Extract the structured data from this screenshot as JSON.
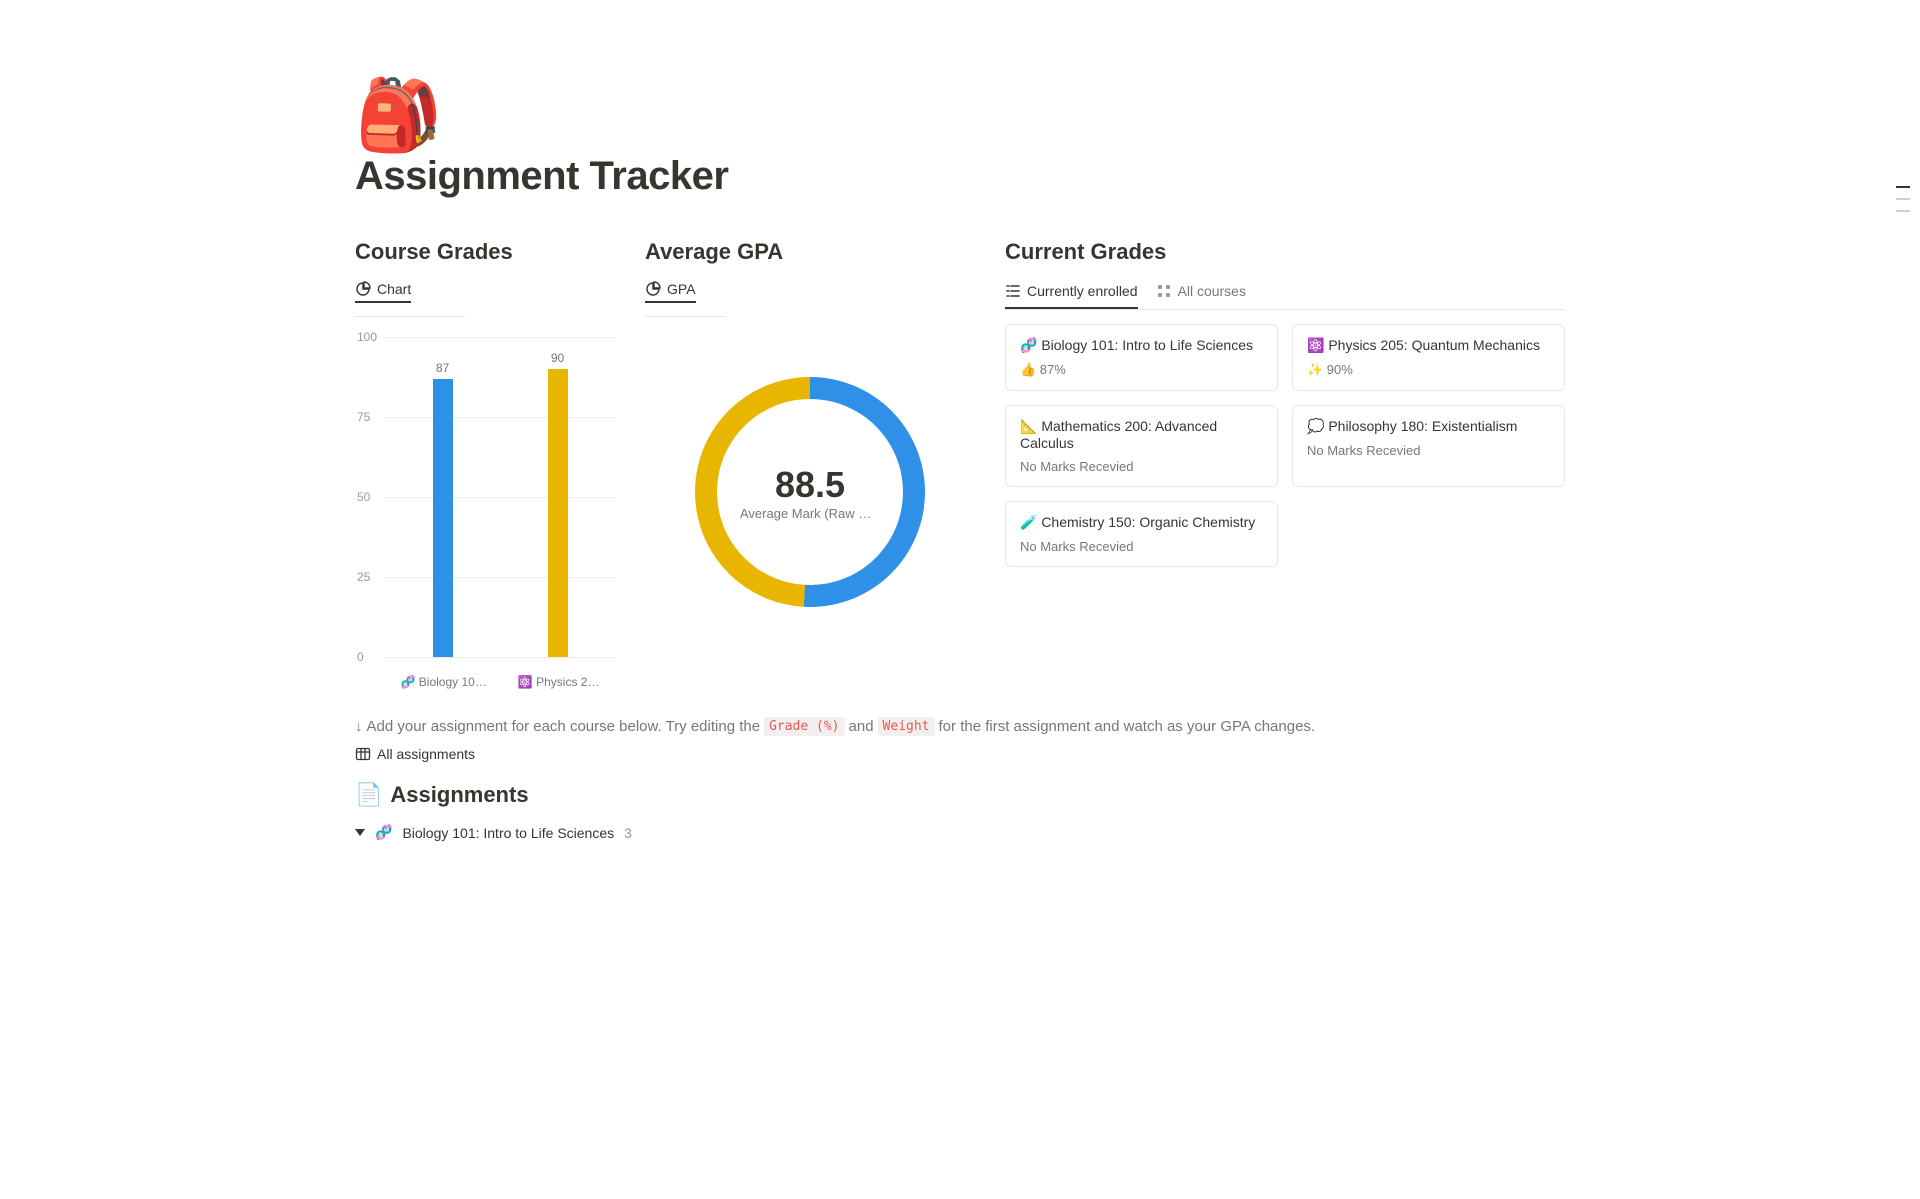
{
  "page": {
    "icon": "🎒",
    "title": "Assignment Tracker"
  },
  "course_grades": {
    "title": "Course Grades",
    "tab_label": "Chart"
  },
  "average_gpa": {
    "title": "Average GPA",
    "tab_label": "GPA",
    "value": "88.5",
    "caption": "Average Mark (Raw Nu…"
  },
  "current_grades": {
    "title": "Current Grades",
    "tabs": [
      {
        "label": "Currently enrolled"
      },
      {
        "label": "All courses"
      }
    ],
    "cards": [
      {
        "emoji": "🧬",
        "title": "Biology 101: Intro to Life Sciences",
        "sub_emoji": "👍",
        "sub": "87%"
      },
      {
        "emoji": "⚛️",
        "title": "Physics 205: Quantum Mechanics",
        "sub_emoji": "✨",
        "sub": "90%"
      },
      {
        "emoji": "📐",
        "title": "Mathematics 200: Advanced Calculus",
        "sub_emoji": "",
        "sub": "No Marks Recevied"
      },
      {
        "emoji": "💭",
        "title": "Philosophy 180: Existentialism",
        "sub_emoji": "",
        "sub": "No Marks Recevied"
      },
      {
        "emoji": "🧪",
        "title": "Chemistry 150: Organic Chemistry",
        "sub_emoji": "",
        "sub": "No Marks Recevied"
      }
    ]
  },
  "hint": {
    "arrow": "↓",
    "part1": "Add your assignment for each course below. Try editing the",
    "code1": "Grade (%)",
    "mid": "and",
    "code2": "Weight",
    "part2": "for the first assignment and watch as your GPA changes."
  },
  "all_assignments_label": "All assignments",
  "assignments_header": {
    "emoji": "📄",
    "title": "Assignments"
  },
  "group": {
    "emoji": "🧬",
    "name": "Biology 101: Intro to Life Sciences",
    "count": "3"
  },
  "chart_data": {
    "type": "bar",
    "title": "Course Grades",
    "ylabel": "",
    "xlabel": "",
    "ylim": [
      0,
      100
    ],
    "yticks": [
      0,
      25,
      50,
      75,
      100
    ],
    "categories": [
      "Biology 10…",
      "Physics 2…"
    ],
    "category_emojis": [
      "🧬",
      "⚛️"
    ],
    "values": [
      87,
      90
    ],
    "colors": [
      "#2e90e6",
      "#e8b500"
    ]
  },
  "donut_data": {
    "type": "pie",
    "value_label": "88.5",
    "caption": "Average Mark (Raw Number)",
    "series": [
      {
        "name": "Physics",
        "value": 90,
        "color": "#2e90e6"
      },
      {
        "name": "Biology",
        "value": 87,
        "color": "#e8b500"
      }
    ]
  }
}
